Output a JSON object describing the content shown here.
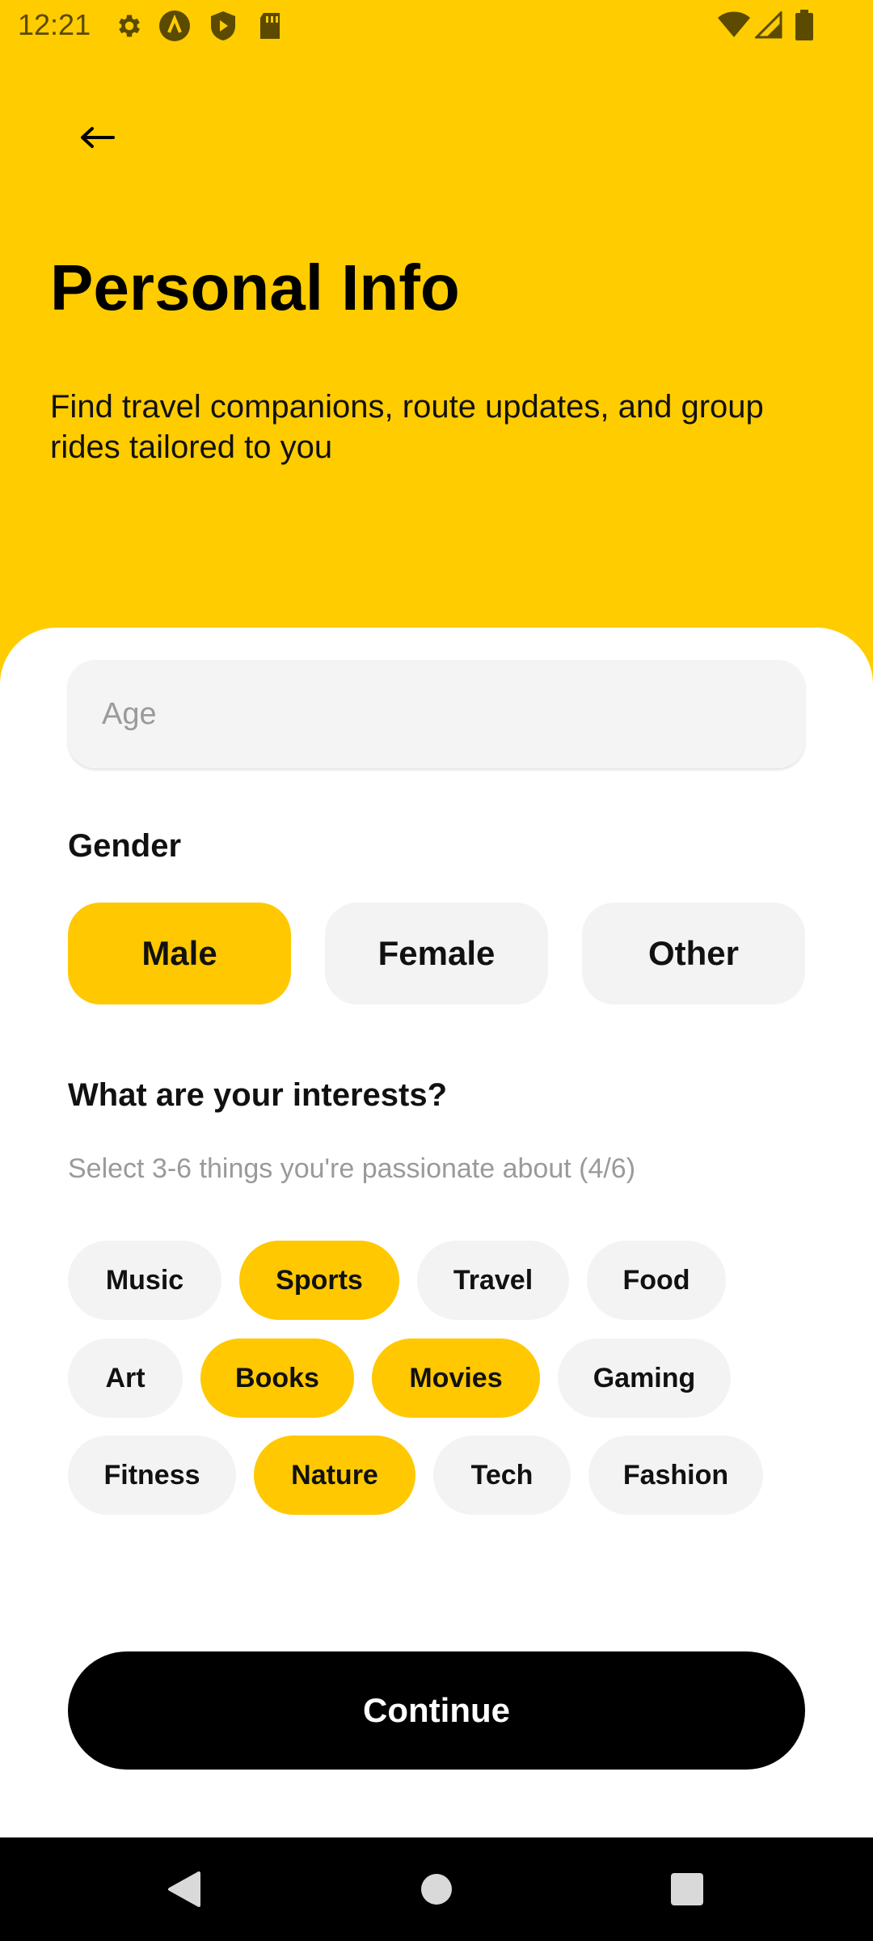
{
  "status_bar": {
    "time": "12:21",
    "icons_left": [
      "gear-icon",
      "a-badge-icon",
      "shield-play-icon",
      "sd-card-icon"
    ],
    "icons_right": [
      "wifi-icon",
      "signal-icon",
      "battery-icon"
    ]
  },
  "header": {
    "back_icon": "arrow-left-icon",
    "title": "Personal Info",
    "subtitle": "Find travel companions, route updates, and group rides tailored to you"
  },
  "form": {
    "age_placeholder": "Age",
    "age_value": "",
    "gender_label": "Gender",
    "gender_options": [
      {
        "label": "Male",
        "selected": true
      },
      {
        "label": "Female",
        "selected": false
      },
      {
        "label": "Other",
        "selected": false
      }
    ],
    "interests_label": "What are your interests?",
    "interests_hint": "Select 3-6 things you're passionate about (4/6)",
    "interests": [
      {
        "label": "Music",
        "selected": false
      },
      {
        "label": "Sports",
        "selected": true
      },
      {
        "label": "Travel",
        "selected": false
      },
      {
        "label": "Food",
        "selected": false
      },
      {
        "label": "Art",
        "selected": false
      },
      {
        "label": "Books",
        "selected": true
      },
      {
        "label": "Movies",
        "selected": true
      },
      {
        "label": "Gaming",
        "selected": false
      },
      {
        "label": "Fitness",
        "selected": false
      },
      {
        "label": "Nature",
        "selected": true
      },
      {
        "label": "Tech",
        "selected": false
      },
      {
        "label": "Fashion",
        "selected": false
      }
    ],
    "continue_label": "Continue"
  },
  "nav_bar": {
    "buttons": [
      "back-triangle-icon",
      "home-circle-icon",
      "recents-square-icon"
    ]
  },
  "colors": {
    "accent": "#FFCC00",
    "chip_selected": "#FFC800",
    "chip_default": "#F3F3F3",
    "primary_button": "#000000"
  }
}
